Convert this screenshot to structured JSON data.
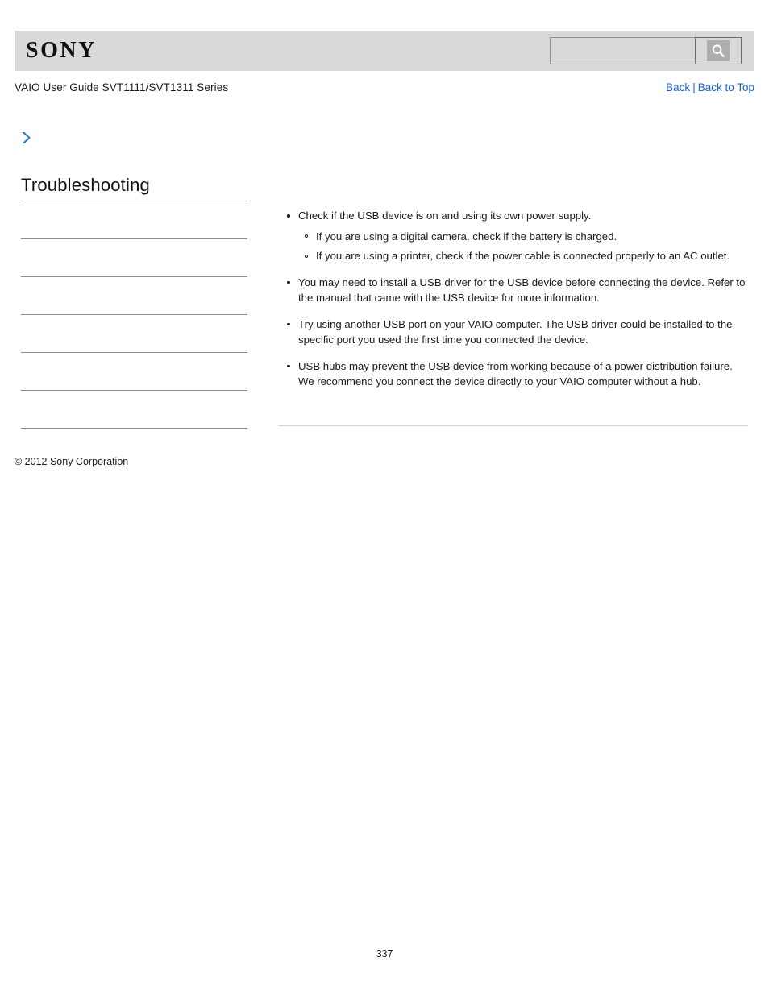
{
  "header": {
    "logo_text": "SONY",
    "search": {
      "value": "",
      "placeholder": "",
      "button_icon": "search-icon"
    }
  },
  "titlebar": {
    "guide_title": "VAIO User Guide SVT1111/SVT1311 Series",
    "links": {
      "back": "Back",
      "separator": "|",
      "back_to_top": "Back to Top"
    }
  },
  "marker": {
    "arrow_icon": "chevron-right-icon",
    "glyph": "❯"
  },
  "sidebar": {
    "heading": "Troubleshooting",
    "items": [
      {
        "label": ""
      },
      {
        "label": ""
      },
      {
        "label": ""
      },
      {
        "label": ""
      },
      {
        "label": ""
      },
      {
        "label": ""
      },
      {
        "label": ""
      }
    ]
  },
  "content": {
    "bullets": [
      {
        "text": "Check if the USB device is on and using its own power supply.",
        "sub": [
          "If you are using a digital camera, check if the battery is charged.",
          "If you are using a printer, check if the power cable is connected properly to an AC outlet."
        ]
      },
      {
        "text": "You may need to install a USB driver for the USB device before connecting the device. Refer to the manual that came with the USB device for more information.",
        "sub": []
      },
      {
        "text": "Try using another USB port on your VAIO computer. The USB driver could be installed to the specific port you used the first time you connected the device.",
        "sub": []
      },
      {
        "text": "USB hubs may prevent the USB device from working because of a power distribution failure. We recommend you connect the device directly to your VAIO computer without a hub.",
        "sub": []
      }
    ]
  },
  "footer": {
    "copyright": "© 2012 Sony Corporation",
    "page_number": "337"
  },
  "colors": {
    "header_band": "#d9d9d9",
    "link_blue": "#1565d8",
    "arrow_blue": "#2b83c4",
    "rule_gray": "#8c8c8c"
  }
}
